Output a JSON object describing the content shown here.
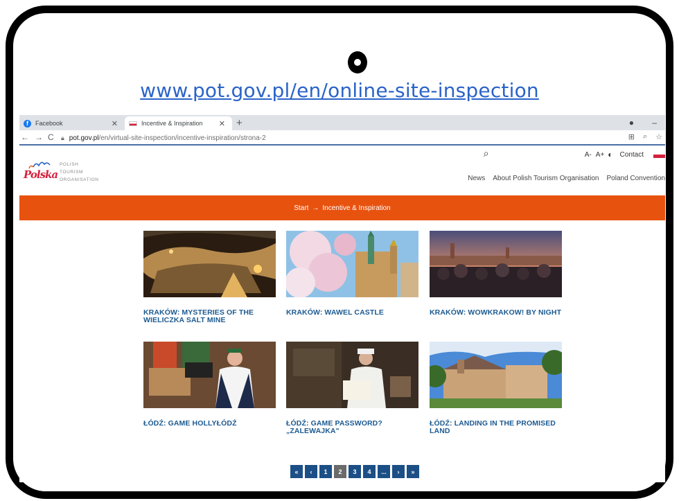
{
  "caption": {
    "url_text": "www.pot.gov.pl/en/online-site-inspection"
  },
  "browser": {
    "tabs": [
      {
        "label": "Facebook",
        "active": false,
        "icon": "facebook-icon"
      },
      {
        "label": "Incentive & Inspiration",
        "active": true,
        "icon": "poland-flag-icon"
      }
    ],
    "new_tab_label": "+",
    "url": {
      "host": "pot.gov.pl",
      "path": "/en/virtual-site-inspection/incentive-inspiration/strona-2"
    }
  },
  "site": {
    "logo": {
      "mark": "Polska",
      "lines": [
        "POLISH",
        "TOURISM",
        "ORGANISATION"
      ]
    },
    "utility": {
      "font_smaller": "A-",
      "font_larger": "A+",
      "contact": "Contact"
    },
    "nav": [
      "News",
      "About Polish Tourism Organisation",
      "Poland Convention"
    ],
    "breadcrumb": {
      "start": "Start",
      "arrow": "→",
      "current": "Incentive & Inspiration"
    },
    "cards": [
      {
        "title": "KRAKÓW: MYSTERIES OF THE WIELICZKA SALT MINE"
      },
      {
        "title": "KRAKÓW: WAWEL CASTLE"
      },
      {
        "title": "KRAKÓW: WOWKRAKOW! BY NIGHT"
      },
      {
        "title": "ŁÓDŹ: GAME HOLLYŁÓDŹ"
      },
      {
        "title": "ŁÓDŹ: GAME PASSWORD? „ZALEWAJKA\""
      },
      {
        "title": "ŁÓDŹ: LANDING IN THE PROMISED LAND"
      }
    ],
    "pagination": {
      "first": "«",
      "prev": "‹",
      "pages": [
        "1",
        "2",
        "3",
        "4"
      ],
      "current": "2",
      "ellipsis": "...",
      "next": "›",
      "last": "»"
    }
  },
  "colors": {
    "accent_orange": "#e8520f",
    "link_blue": "#1c5a91",
    "caption_blue": "#2a63c8",
    "pager_blue": "#1c4f86"
  }
}
